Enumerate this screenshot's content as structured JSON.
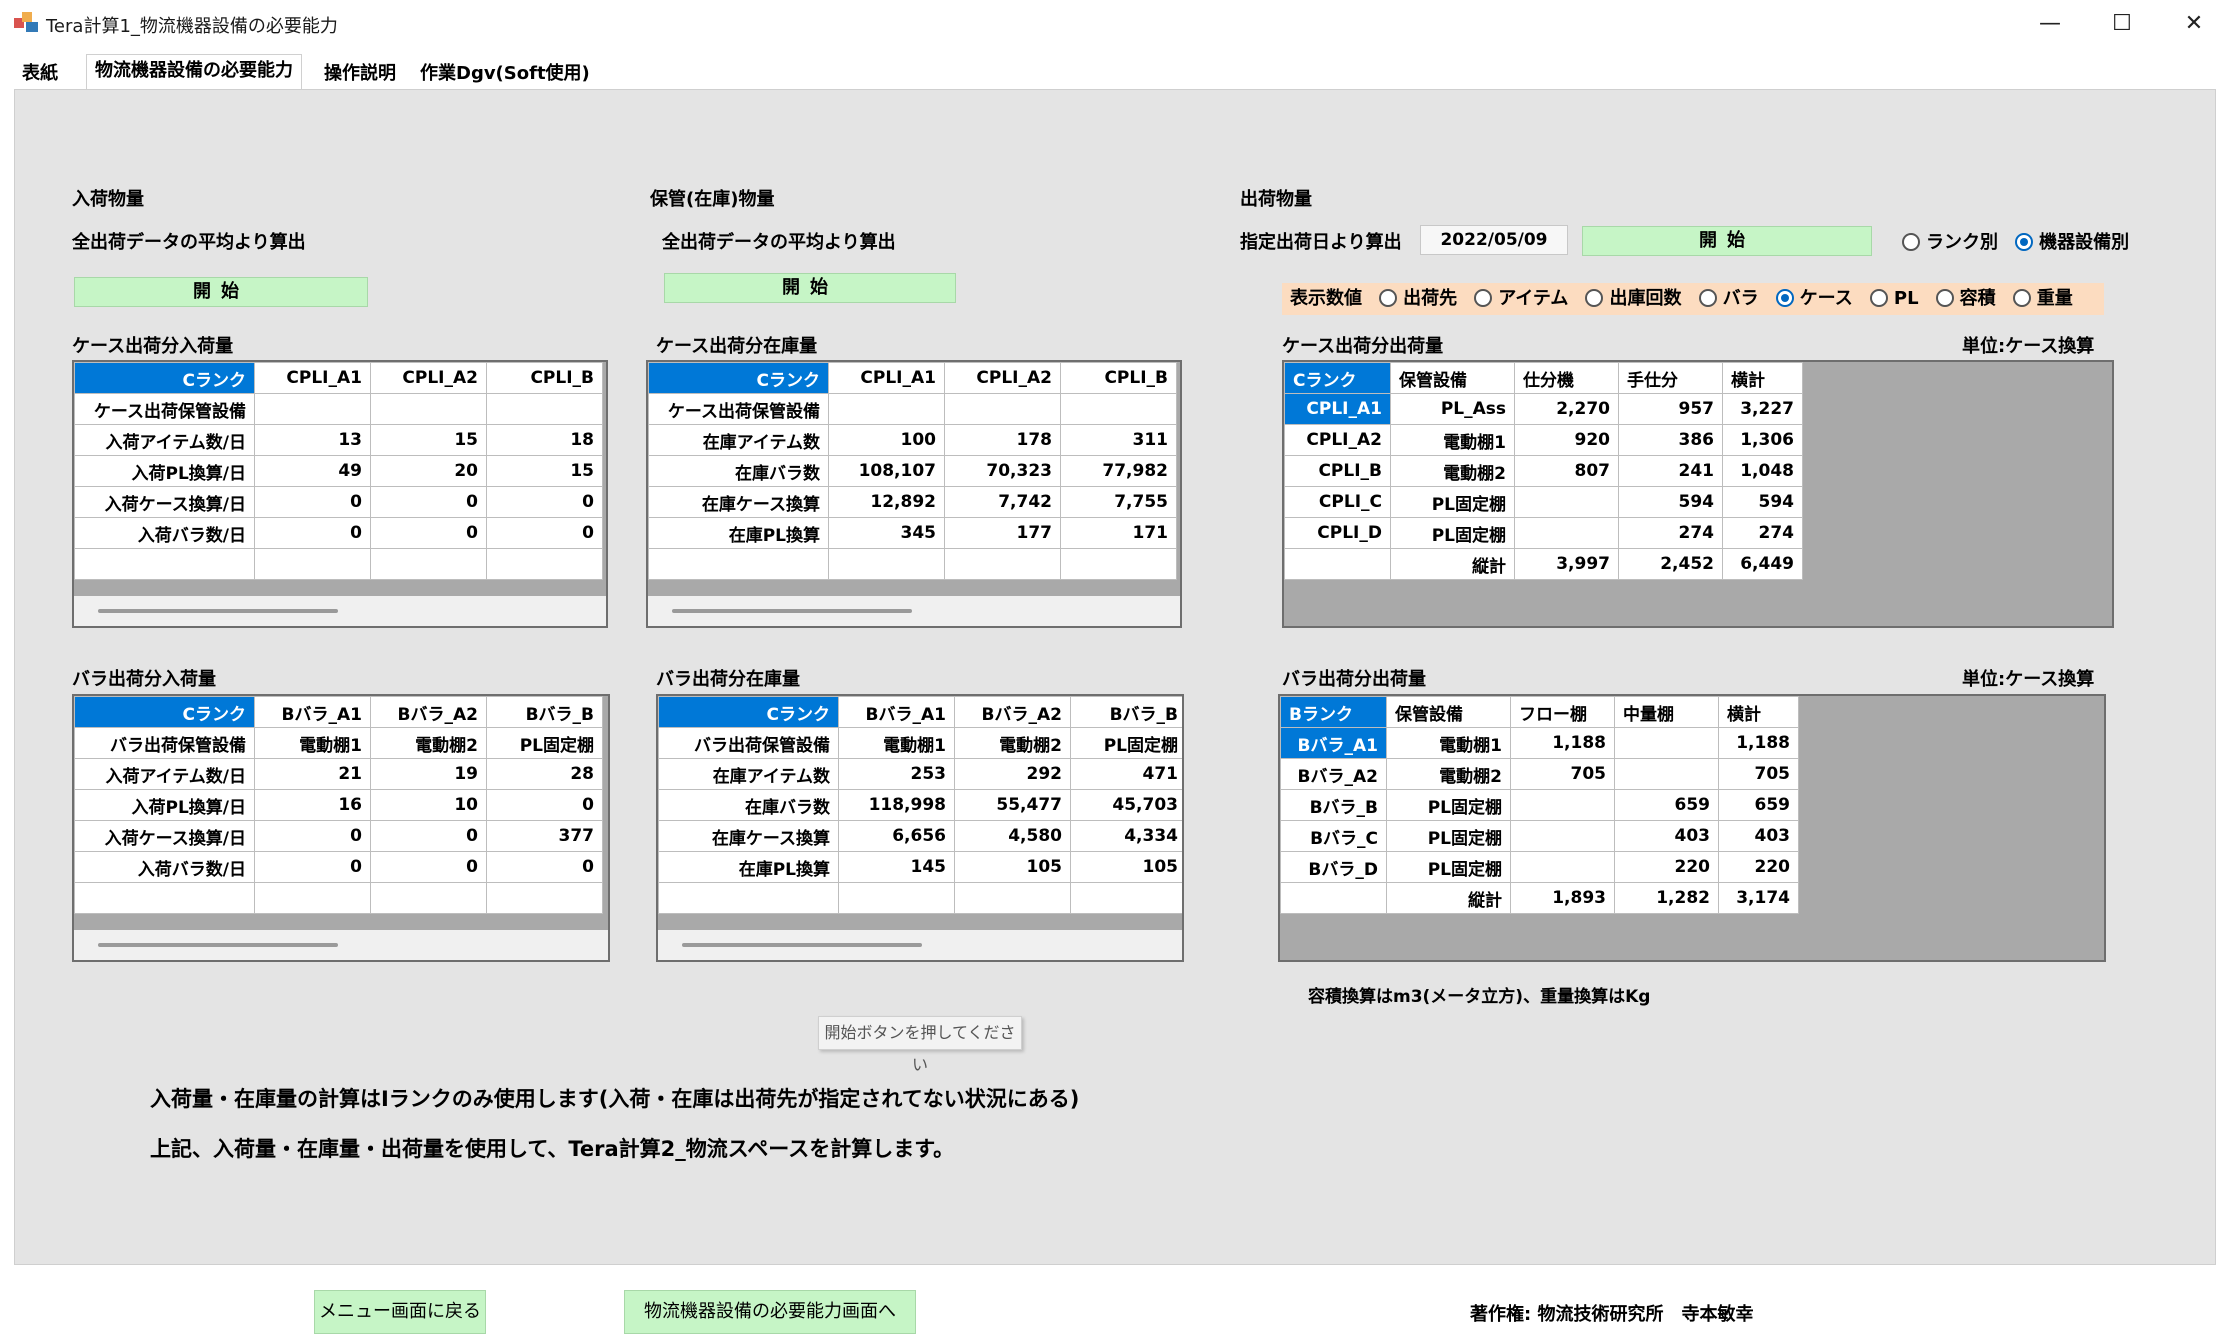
{
  "window": {
    "title": "Tera計算1_物流機器設備の必要能力",
    "min": "—",
    "max": "☐",
    "close": "✕"
  },
  "tabs": [
    {
      "label": "表紙"
    },
    {
      "label": "物流機器設備の必要能力"
    },
    {
      "label": "操作説明"
    },
    {
      "label": "作業Dgv(Soft使用)"
    }
  ],
  "inbound": {
    "title": "入荷物量",
    "subtitle": "全出荷データの平均より算出",
    "start_button": "開始"
  },
  "storage": {
    "title": "保管(在庫)物量",
    "subtitle": "全出荷データの平均より算出",
    "start_button": "開始"
  },
  "outbound": {
    "title": "出荷物量",
    "date_label": "指定出荷日より算出",
    "date_value": "2022/05/09",
    "start_button": "開始",
    "mode_options": [
      {
        "label": "ランク別",
        "checked": false
      },
      {
        "label": "機器設備別",
        "checked": true
      }
    ],
    "display_label": "表示数値",
    "display_options": [
      {
        "label": "出荷先",
        "checked": false
      },
      {
        "label": "アイテム",
        "checked": false
      },
      {
        "label": "出庫回数",
        "checked": false
      },
      {
        "label": "バラ",
        "checked": false
      },
      {
        "label": "ケース",
        "checked": true
      },
      {
        "label": "PL",
        "checked": false
      },
      {
        "label": "容積",
        "checked": false
      },
      {
        "label": "重量",
        "checked": false
      }
    ],
    "unit_label": "単位:ケース換算"
  },
  "grid_case_in": {
    "title": "ケース出荷分入荷量",
    "headers": [
      "Cランク",
      "CPLI_A1",
      "CPLI_A2",
      "CPLI_B"
    ],
    "rows": [
      [
        "ケース出荷保管設備",
        "",
        "",
        ""
      ],
      [
        "入荷アイテム数/日",
        "13",
        "15",
        "18"
      ],
      [
        "入荷PL換算/日",
        "49",
        "20",
        "15"
      ],
      [
        "入荷ケース換算/日",
        "0",
        "0",
        "0"
      ],
      [
        "入荷バラ数/日",
        "0",
        "0",
        "0"
      ],
      [
        "",
        "",
        "",
        ""
      ]
    ]
  },
  "grid_case_stock": {
    "title": "ケース出荷分在庫量",
    "headers": [
      "Cランク",
      "CPLI_A1",
      "CPLI_A2",
      "CPLI_B"
    ],
    "rows": [
      [
        "ケース出荷保管設備",
        "",
        "",
        ""
      ],
      [
        "在庫アイテム数",
        "100",
        "178",
        "311"
      ],
      [
        "在庫バラ数",
        "108,107",
        "70,323",
        "77,982"
      ],
      [
        "在庫ケース換算",
        "12,892",
        "7,742",
        "7,755"
      ],
      [
        "在庫PL換算",
        "345",
        "177",
        "171"
      ],
      [
        "",
        "",
        "",
        ""
      ]
    ]
  },
  "grid_case_out": {
    "title": "ケース出荷分出荷量",
    "headers": [
      "Cランク",
      "保管設備",
      "仕分機",
      "手仕分",
      "横計"
    ],
    "rows": [
      [
        "CPLI_A1",
        "PL_Ass",
        "2,270",
        "957",
        "3,227"
      ],
      [
        "CPLI_A2",
        "電動棚1",
        "920",
        "386",
        "1,306"
      ],
      [
        "CPLI_B",
        "電動棚2",
        "807",
        "241",
        "1,048"
      ],
      [
        "CPLI_C",
        "PL固定棚",
        "",
        "594",
        "594"
      ],
      [
        "CPLI_D",
        "PL固定棚",
        "",
        "274",
        "274"
      ],
      [
        "",
        "縦計",
        "3,997",
        "2,452",
        "6,449"
      ]
    ]
  },
  "grid_bara_in": {
    "title": "バラ出荷分入荷量",
    "headers": [
      "Cランク",
      "Bバラ_A1",
      "Bバラ_A2",
      "Bバラ_B"
    ],
    "rows": [
      [
        "バラ出荷保管設備",
        "電動棚1",
        "電動棚2",
        "PL固定棚"
      ],
      [
        "入荷アイテム数/日",
        "21",
        "19",
        "28"
      ],
      [
        "入荷PL換算/日",
        "16",
        "10",
        "0"
      ],
      [
        "入荷ケース換算/日",
        "0",
        "0",
        "377"
      ],
      [
        "入荷バラ数/日",
        "0",
        "0",
        "0"
      ],
      [
        "",
        "",
        "",
        ""
      ]
    ]
  },
  "grid_bara_stock": {
    "title": "バラ出荷分在庫量",
    "headers": [
      "Cランク",
      "Bバラ_A1",
      "Bバラ_A2",
      "Bバラ_B"
    ],
    "rows": [
      [
        "バラ出荷保管設備",
        "電動棚1",
        "電動棚2",
        "PL固定棚"
      ],
      [
        "在庫アイテム数",
        "253",
        "292",
        "471"
      ],
      [
        "在庫バラ数",
        "118,998",
        "55,477",
        "45,703"
      ],
      [
        "在庫ケース換算",
        "6,656",
        "4,580",
        "4,334"
      ],
      [
        "在庫PL換算",
        "145",
        "105",
        "105"
      ],
      [
        "",
        "",
        "",
        ""
      ]
    ]
  },
  "grid_bara_out": {
    "title": "バラ出荷分出荷量",
    "unit_label": "単位:ケース換算",
    "headers": [
      "Bランク",
      "保管設備",
      "フロー棚",
      "中量棚",
      "横計"
    ],
    "rows": [
      [
        "Bバラ_A1",
        "電動棚1",
        "1,188",
        "",
        "1,188"
      ],
      [
        "Bバラ_A2",
        "電動棚2",
        "705",
        "",
        "705"
      ],
      [
        "Bバラ_B",
        "PL固定棚",
        "",
        "659",
        "659"
      ],
      [
        "Bバラ_C",
        "PL固定棚",
        "",
        "403",
        "403"
      ],
      [
        "Bバラ_D",
        "PL固定棚",
        "",
        "220",
        "220"
      ],
      [
        "",
        "縦計",
        "1,893",
        "1,282",
        "3,174"
      ]
    ]
  },
  "notes": {
    "volume_note": "容積換算はm3(メータ立方)、重量換算はKg",
    "tooltip": "開始ボタンを押してください",
    "line1": "入荷量・在庫量の計算はIランクのみ使用します(入荷・在庫は出荷先が指定されてない状況にある)",
    "line2": "上記、入荷量・在庫量・出荷量を使用して、Tera計算2_物流スペースを計算します。"
  },
  "footer": {
    "menu_button": "メニュー画面に戻る",
    "next_button": "物流機器設備の必要能力画面へ",
    "copyright": "著作権: 物流技術研究所　寺本敏幸"
  },
  "colors": {
    "selected_cell": "#0078d7",
    "green_button": "#c6f5c6",
    "display_bar": "#fcdcc0",
    "panel": "#e4e4e4"
  }
}
